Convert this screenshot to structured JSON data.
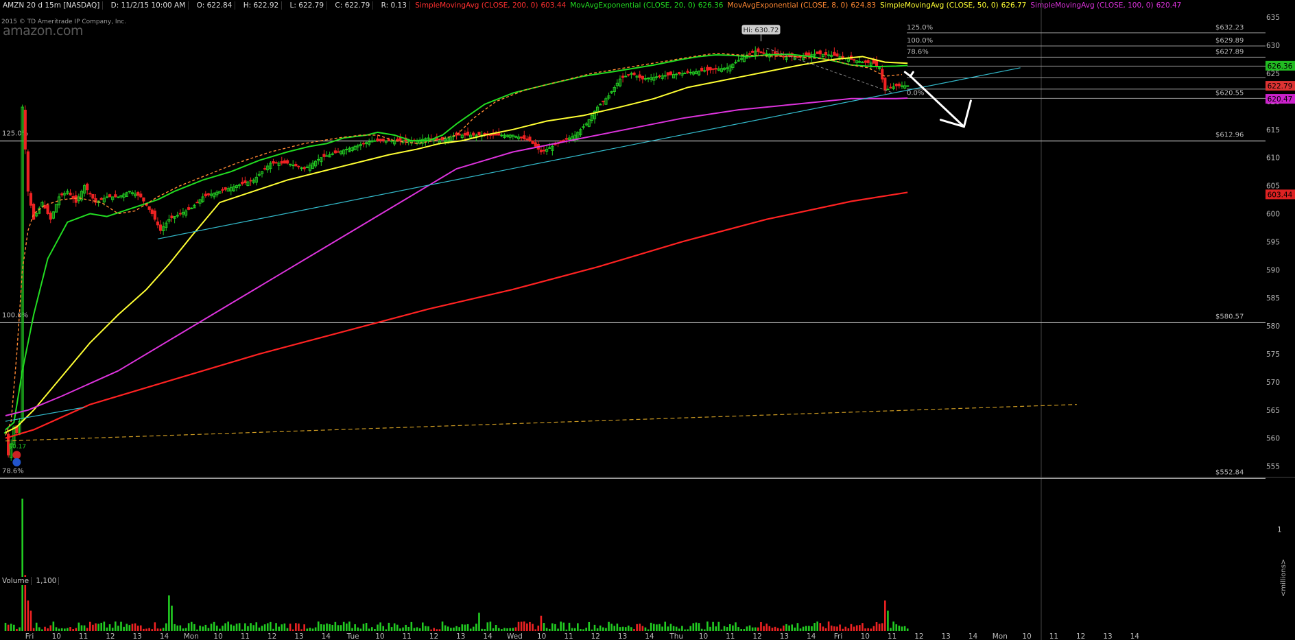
{
  "header": {
    "symbol": "AMZN 20 d 15m [NASDAQ]",
    "date": "D: 11/2/15 10:00 AM",
    "open": "O: 622.84",
    "high": "H: 622.92",
    "low": "L: 622.79",
    "close": "C: 622.79",
    "range": "R: 0.13",
    "studies": [
      {
        "label": "SimpleMovingAvg (CLOSE, 200, 0)",
        "value": "603.44",
        "color": "#ff3030"
      },
      {
        "label": "MovAvgExponential (CLOSE, 20, 0)",
        "value": "626.36",
        "color": "#22dd22"
      },
      {
        "label": "MovAvgExponential (CLOSE, 8, 0)",
        "value": "624.83",
        "color": "#ff8833"
      },
      {
        "label": "SimpleMovingAvg (CLOSE, 50, 0)",
        "value": "626.77",
        "color": "#ffff33"
      },
      {
        "label": "SimpleMovingAvg (CLOSE, 100, 0)",
        "value": "620.47",
        "color": "#dd33dd"
      }
    ]
  },
  "copyright": "2015 © TD Ameritrade IP Company, Inc.",
  "watermark": "amazon.com",
  "volume_panel": {
    "label": "Volume",
    "value": "1,100",
    "axis_tick": "1",
    "unit": "<millions>"
  },
  "chart_data": {
    "type": "line",
    "price_axis": {
      "ylim": [
        553,
        636
      ],
      "ticks": [
        555,
        560,
        565,
        570,
        575,
        580,
        585,
        590,
        595,
        600,
        605,
        610,
        615,
        620,
        625,
        630,
        635
      ]
    },
    "time_labels": [
      "Fri",
      "10",
      "11",
      "12",
      "13",
      "14",
      "Mon",
      "10",
      "11",
      "12",
      "13",
      "14",
      "Tue",
      "10",
      "11",
      "12",
      "13",
      "14",
      "Wed",
      "10",
      "11",
      "12",
      "13",
      "14",
      "Thu",
      "10",
      "11",
      "12",
      "13",
      "14",
      "Fri",
      "10",
      "11",
      "12",
      "13",
      "14",
      "Mon",
      "10",
      "11",
      "12",
      "13",
      "14"
    ],
    "series": [
      {
        "color": "#22dd22",
        "width": 2,
        "dash": "",
        "x": [
          0,
          3,
          6,
          10,
          15,
          22,
          30,
          36,
          45,
          54,
          60,
          70,
          80,
          90,
          100,
          108,
          114,
          120,
          128,
          132,
          138,
          144,
          150,
          155,
          160,
          170,
          180,
          192,
          205,
          218,
          230,
          240,
          246,
          252,
          258,
          264,
          270,
          278,
          286,
          294,
          300,
          308,
          316,
          320
        ],
        "y": [
          561.5,
          562.8,
          572,
          582,
          592,
          598.5,
          600,
          599.5,
          601,
          602.5,
          604,
          606,
          607.5,
          609.5,
          611,
          612,
          612.5,
          613.5,
          614,
          614.5,
          614,
          613,
          613,
          614,
          616,
          619.5,
          621.5,
          623,
          624.5,
          625.5,
          626.5,
          627.5,
          628,
          628.3,
          628.2,
          628,
          628.3,
          628.4,
          628,
          627.2,
          626.5,
          626.2,
          626.3,
          626.4
        ]
      },
      {
        "color": "#ffff33",
        "width": 2,
        "dash": "",
        "x": [
          0,
          4,
          10,
          20,
          30,
          40,
          50,
          58,
          66,
          76,
          88,
          100,
          112,
          124,
          136,
          146,
          154,
          162,
          170,
          180,
          192,
          205,
          218,
          230,
          242,
          252,
          262,
          272,
          282,
          294,
          304,
          312,
          320
        ],
        "y": [
          561,
          562,
          565,
          571,
          577,
          582,
          586.5,
          591,
          596,
          602,
          604,
          606,
          607.5,
          609,
          610.5,
          611.5,
          612.5,
          613,
          614,
          615,
          616.5,
          617.5,
          619,
          620.5,
          622.5,
          623.5,
          624.5,
          625.5,
          626.5,
          627.5,
          628,
          627,
          626.8
        ]
      },
      {
        "color": "#dd33dd",
        "width": 2,
        "dash": "",
        "x": [
          0,
          8,
          20,
          40,
          60,
          80,
          100,
          120,
          140,
          160,
          170,
          180,
          200,
          220,
          240,
          260,
          280,
          300,
          316,
          320
        ],
        "y": [
          564,
          565,
          567.5,
          572,
          578,
          584,
          590,
          596,
          602,
          608,
          609.5,
          611,
          613,
          615,
          617,
          618.5,
          619.5,
          620.5,
          620.5,
          620.6
        ]
      },
      {
        "color": "#ff2222",
        "width": 2.2,
        "dash": "",
        "x": [
          0,
          10,
          30,
          60,
          90,
          120,
          150,
          180,
          210,
          240,
          270,
          300,
          320
        ],
        "y": [
          560,
          561.5,
          566,
          570.5,
          575,
          579,
          583,
          586.5,
          590.5,
          595,
          599,
          602.2,
          603.8
        ]
      },
      {
        "color": "#ff8833",
        "width": 1.4,
        "dash": "4,3",
        "x": [
          0,
          2,
          4,
          6,
          8,
          10,
          14,
          20,
          26,
          34,
          40,
          46,
          54,
          62,
          72,
          82,
          94,
          106,
          118,
          126,
          132,
          138,
          146,
          152,
          160,
          166,
          174,
          184,
          196,
          208,
          220,
          232,
          244,
          252,
          260,
          270,
          280,
          292,
          300,
          306,
          312,
          318
        ],
        "y": [
          560.5,
          563,
          575,
          590,
          597,
          600,
          601.5,
          602.5,
          602.8,
          602,
          600,
          600.5,
          603,
          605,
          607,
          609,
          611,
          612.5,
          613.5,
          614,
          614,
          613,
          612.5,
          613,
          614,
          617,
          620,
          622,
          623.5,
          625,
          626,
          627,
          628,
          628.6,
          628.3,
          628.1,
          628,
          627.5,
          626.5,
          626,
          624.5,
          624.8
        ]
      },
      {
        "color": "#33bbcc",
        "width": 1.2,
        "dash": "",
        "x": [
          54,
          360
        ],
        "y": [
          595.5,
          626
        ]
      },
      {
        "color": "#33bbcc",
        "width": 1.2,
        "dash": "",
        "x": [
          0,
          28
        ],
        "y": [
          563,
          565.5
        ]
      },
      {
        "color": "#cc9a22",
        "width": 1.2,
        "dash": "6,4",
        "x": [
          0,
          380
        ],
        "y": [
          559.5,
          566
        ]
      },
      {
        "color": "#888888",
        "width": 1,
        "dash": "4,3",
        "x": [
          270,
          315
        ],
        "y": [
          629.5,
          621.5
        ]
      }
    ],
    "fibonacci_left": [
      {
        "level": 612.96,
        "label": "125.0%",
        "right_label": "$612.96"
      },
      {
        "level": 580.57,
        "label": "100.0%",
        "right_label": "$580.57"
      },
      {
        "level": 552.84,
        "label": "78.6%",
        "right_label": "$552.84"
      }
    ],
    "fibonacci_right": [
      {
        "level": 632.23,
        "label": "125.0%",
        "right_label": "$632.23"
      },
      {
        "level": 629.89,
        "label": "100.0%",
        "right_label": "$629.89"
      },
      {
        "level": 627.89,
        "label": "78.6%",
        "right_label": "$627.89"
      },
      {
        "level": 626.3,
        "label": "",
        "right_label": ""
      },
      {
        "level": 624.2,
        "label": "",
        "right_label": ""
      },
      {
        "level": 622.2,
        "label": "",
        "right_label": ""
      },
      {
        "level": 620.55,
        "label": "0.0%",
        "right_label": "$620.55"
      }
    ],
    "price_markers": [
      {
        "value": 626.36,
        "label": "626.36",
        "bg": "#22bb22"
      },
      {
        "value": 622.79,
        "label": "622.79",
        "bg": "#dd3333"
      },
      {
        "value": 620.47,
        "label": "620.47",
        "bg": "#cc22cc"
      },
      {
        "value": 603.44,
        "label": "603.44",
        "bg": "#dd2222"
      }
    ],
    "hi_annotation": {
      "label": "Hi: 630.72",
      "x": 268,
      "y": 630.72
    },
    "dividend": {
      "label": "$0.17",
      "x": 3
    },
    "candles": {
      "x_start": 0,
      "x_end": 320,
      "anchors": [
        [
          0,
          561
        ],
        [
          1,
          557
        ],
        [
          2,
          559
        ],
        [
          3,
          562
        ],
        [
          4,
          561
        ],
        [
          5,
          563
        ],
        [
          6,
          619
        ],
        [
          8,
          604
        ],
        [
          10,
          599
        ],
        [
          13,
          602
        ],
        [
          16,
          599
        ],
        [
          19,
          603
        ],
        [
          22,
          604
        ],
        [
          25,
          602
        ],
        [
          28,
          605
        ],
        [
          32,
          602
        ],
        [
          36,
          603
        ],
        [
          40,
          603
        ],
        [
          44,
          604
        ],
        [
          48,
          603
        ],
        [
          52,
          600
        ],
        [
          55,
          597
        ],
        [
          58,
          599
        ],
        [
          62,
          600
        ],
        [
          66,
          601
        ],
        [
          70,
          603
        ],
        [
          76,
          604
        ],
        [
          82,
          605
        ],
        [
          88,
          606
        ],
        [
          94,
          609
        ],
        [
          100,
          609
        ],
        [
          106,
          608
        ],
        [
          112,
          610
        ],
        [
          118,
          611
        ],
        [
          124,
          612
        ],
        [
          130,
          613
        ],
        [
          136,
          613
        ],
        [
          142,
          613
        ],
        [
          146,
          613
        ],
        [
          150,
          613.5
        ],
        [
          154,
          613
        ],
        [
          160,
          614
        ],
        [
          166,
          614
        ],
        [
          172,
          614
        ],
        [
          180,
          614
        ],
        [
          186,
          613
        ],
        [
          190,
          611
        ],
        [
          194,
          612
        ],
        [
          198,
          613
        ],
        [
          202,
          614
        ],
        [
          206,
          616
        ],
        [
          210,
          619
        ],
        [
          214,
          621
        ],
        [
          218,
          624
        ],
        [
          222,
          625
        ],
        [
          226,
          624
        ],
        [
          232,
          624.5
        ],
        [
          240,
          625
        ],
        [
          248,
          625.5
        ],
        [
          256,
          626
        ],
        [
          262,
          628
        ],
        [
          266,
          629
        ],
        [
          270,
          628.5
        ],
        [
          276,
          628
        ],
        [
          282,
          628
        ],
        [
          288,
          628.5
        ],
        [
          294,
          628.2
        ],
        [
          300,
          627.5
        ],
        [
          304,
          627
        ],
        [
          308,
          626.8
        ],
        [
          310,
          626
        ],
        [
          312,
          622
        ],
        [
          316,
          622.8
        ],
        [
          320,
          622.8
        ]
      ]
    },
    "volume": {
      "ylim": [
        0,
        1.4
      ],
      "bars": [
        [
          6,
          1.3
        ],
        [
          7,
          0.55
        ],
        [
          8,
          0.3
        ],
        [
          9,
          0.2
        ],
        [
          58,
          0.35
        ],
        [
          59,
          0.25
        ],
        [
          168,
          0.18
        ],
        [
          190,
          0.15
        ],
        [
          312,
          0.3
        ],
        [
          313,
          0.2
        ]
      ]
    },
    "arrow": {
      "from": [
        321,
        624.5
      ],
      "to": [
        340,
        615.5
      ],
      "color": "#ffffff"
    }
  }
}
